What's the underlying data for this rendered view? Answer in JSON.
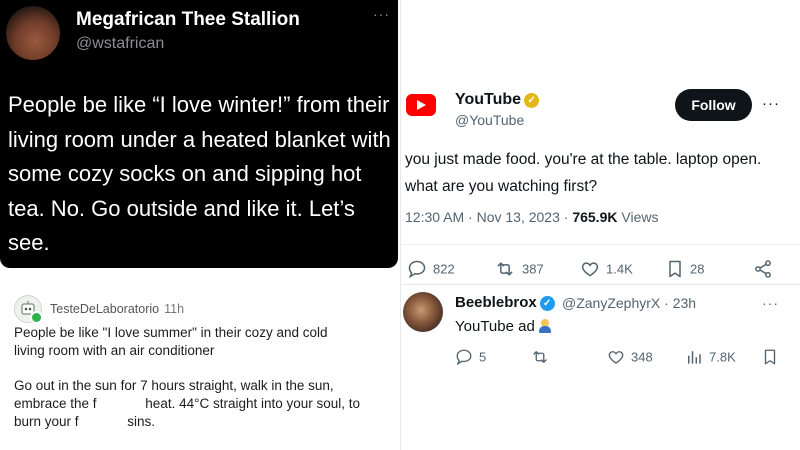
{
  "dark_post": {
    "name": "Megafrican Thee Stallion",
    "handle": "@wstafrican",
    "more": "···",
    "text": "People be like “I love winter!” from their  living room under a heated blanket with some cozy socks on and sipping hot tea. No. Go outside and like it. Let’s see."
  },
  "light_post": {
    "username": "TesteDeLaboratorio",
    "time": "11h",
    "lines": [
      "People be like \"I love summer\" in their cozy and cold",
      "living room with an air conditioner",
      "Go out in the sun for 7 hours straight, walk in the sun,",
      "embrace the f             heat. 44°C straight into your soul, to",
      "burn your f             sins."
    ]
  },
  "youtube_post": {
    "name": "YouTube",
    "handle": "@YouTube",
    "follow_label": "Follow",
    "more": "···",
    "text": "you just made food. you're at the table. laptop open. what are you watching first?",
    "meta_prefix": "12:30 AM · Nov 13, 2023 · ",
    "views_count": "765.9K",
    "views_label": " Views",
    "actions": {
      "replies": "822",
      "reposts": "387",
      "likes": "1.4K",
      "bookmarks": "28"
    }
  },
  "reply_post": {
    "name": "Beeblebrox",
    "handle": "@ZanyZephyrX · 23h",
    "more": "···",
    "text": "YouTube ad",
    "emoji": "man-technologist-emoji",
    "actions": {
      "replies": "5",
      "likes": "348",
      "views": "7.8K"
    }
  },
  "colors": {
    "youtube_red": "#ff0000",
    "verified_gold": "#e2b719",
    "verified_blue": "#1d9bf0",
    "online_green": "#30b14a"
  }
}
